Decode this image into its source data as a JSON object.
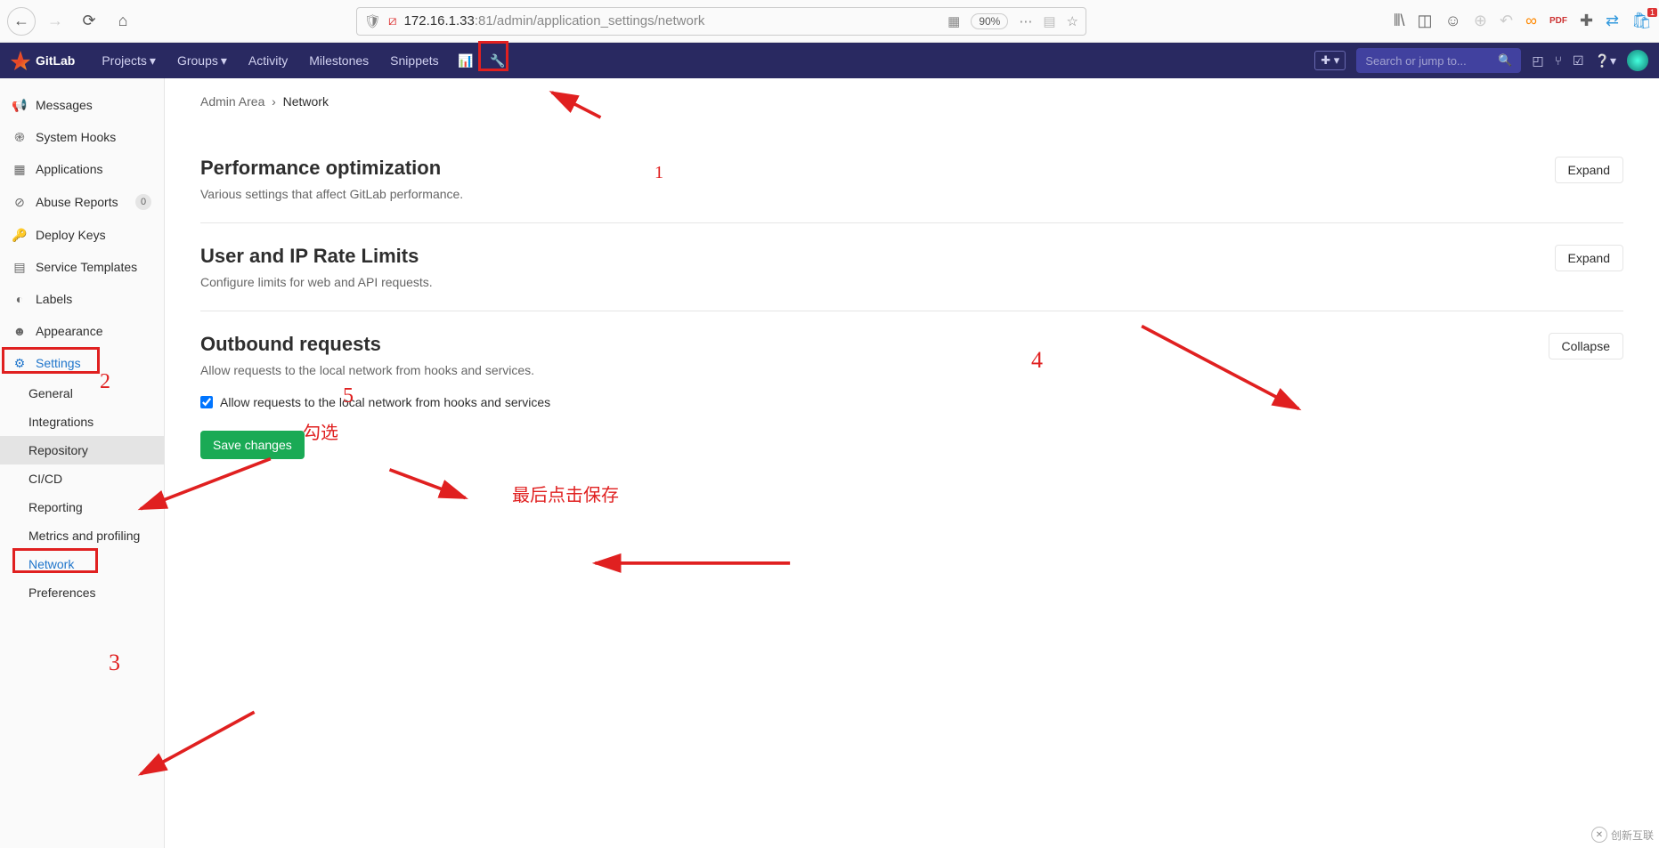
{
  "browser": {
    "url_host": "172.16.1.33",
    "url_rest": ":81/admin/application_settings/network",
    "zoom": "90%"
  },
  "topnav": {
    "brand": "GitLab",
    "projects": "Projects",
    "groups": "Groups",
    "activity": "Activity",
    "milestones": "Milestones",
    "snippets": "Snippets",
    "search_placeholder": "Search or jump to..."
  },
  "sidebar": {
    "messages": "Messages",
    "system_hooks": "System Hooks",
    "applications": "Applications",
    "abuse_reports": "Abuse Reports",
    "abuse_badge": "0",
    "deploy_keys": "Deploy Keys",
    "service_templates": "Service Templates",
    "labels": "Labels",
    "appearance": "Appearance",
    "settings": "Settings",
    "general": "General",
    "integrations": "Integrations",
    "repository": "Repository",
    "cicd": "CI/CD",
    "reporting": "Reporting",
    "metrics": "Metrics and profiling",
    "network": "Network",
    "preferences": "Preferences"
  },
  "breadcrumb": {
    "admin": "Admin Area",
    "current": "Network"
  },
  "sections": {
    "perf": {
      "title": "Performance optimization",
      "desc": "Various settings that affect GitLab performance.",
      "btn": "Expand"
    },
    "rate": {
      "title": "User and IP Rate Limits",
      "desc": "Configure limits for web and API requests.",
      "btn": "Expand"
    },
    "outbound": {
      "title": "Outbound requests",
      "desc": "Allow requests to the local network from hooks and services.",
      "btn": "Collapse",
      "checkbox": "Allow requests to the local network from hooks and services",
      "save": "Save changes"
    }
  },
  "annotations": {
    "n1": "1",
    "n2": "2",
    "n3": "3",
    "n4": "4",
    "n5": "5",
    "check": "勾选",
    "final": "最后点击保存"
  },
  "watermark": "创新互联"
}
